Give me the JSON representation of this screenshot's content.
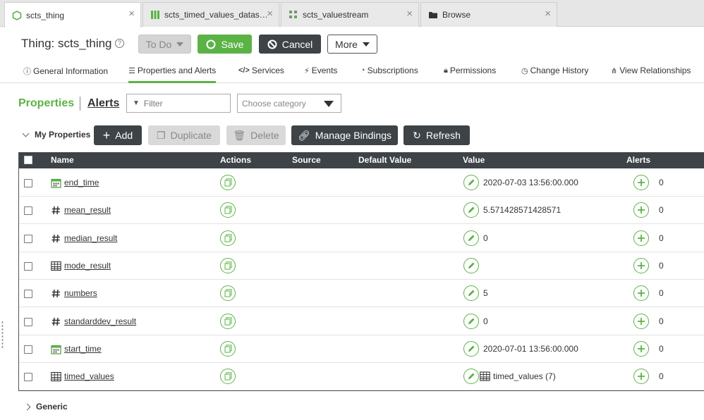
{
  "tabs": [
    {
      "label": "scts_thing",
      "icon": "thing-icon",
      "active": true
    },
    {
      "label": "scts_timed_values_datas…",
      "icon": "datashape-icon",
      "active": false
    },
    {
      "label": "scts_valuestream",
      "icon": "valuestream-icon",
      "active": false
    },
    {
      "label": "Browse",
      "icon": "folder-icon",
      "active": false
    }
  ],
  "header": {
    "title": "Thing: scts_thing",
    "todo_label": "To Do",
    "save_label": "Save",
    "cancel_label": "Cancel",
    "more_label": "More"
  },
  "nav": [
    {
      "label": "General Information",
      "icon": "info-icon"
    },
    {
      "label": "Properties and Alerts",
      "icon": "list-icon",
      "active": true
    },
    {
      "label": "Services",
      "icon": "code-icon"
    },
    {
      "label": "Events",
      "icon": "bolt-icon"
    },
    {
      "label": "Subscriptions",
      "icon": "rss-icon"
    },
    {
      "label": "Permissions",
      "icon": "lock-icon"
    },
    {
      "label": "Change History",
      "icon": "clock-icon"
    },
    {
      "label": "View Relationships",
      "icon": "relationships-icon"
    }
  ],
  "section": {
    "properties_label": "Properties",
    "alerts_label": "Alerts",
    "filter_placeholder": "Filter",
    "category_placeholder": "Choose category"
  },
  "toolbar": {
    "group_label": "My Properties",
    "add_label": "Add",
    "duplicate_label": "Duplicate",
    "delete_label": "Delete",
    "bindings_label": "Manage Bindings",
    "refresh_label": "Refresh"
  },
  "table": {
    "columns": [
      "Name",
      "Actions",
      "Source",
      "Default Value",
      "Value",
      "Alerts"
    ],
    "rows": [
      {
        "name": "end_time",
        "type": "datetime",
        "value": "2020-07-03 13:56:00.000",
        "alerts": "0"
      },
      {
        "name": "mean_result",
        "type": "number",
        "value": "5.571428571428571",
        "alerts": "0"
      },
      {
        "name": "median_result",
        "type": "number",
        "value": "0",
        "alerts": "0"
      },
      {
        "name": "mode_result",
        "type": "infotable",
        "value": "",
        "alerts": "0"
      },
      {
        "name": "numbers",
        "type": "number",
        "value": "5",
        "alerts": "0"
      },
      {
        "name": "standarddev_result",
        "type": "number",
        "value": "0",
        "alerts": "0"
      },
      {
        "name": "start_time",
        "type": "datetime",
        "value": "2020-07-01 13:56:00.000",
        "alerts": "0"
      },
      {
        "name": "timed_values",
        "type": "infotable",
        "value": "timed_values (7)",
        "alerts": "0"
      }
    ]
  },
  "generic_label": "Generic",
  "colors": {
    "accent": "#5bb346",
    "dark": "#3d4347"
  }
}
